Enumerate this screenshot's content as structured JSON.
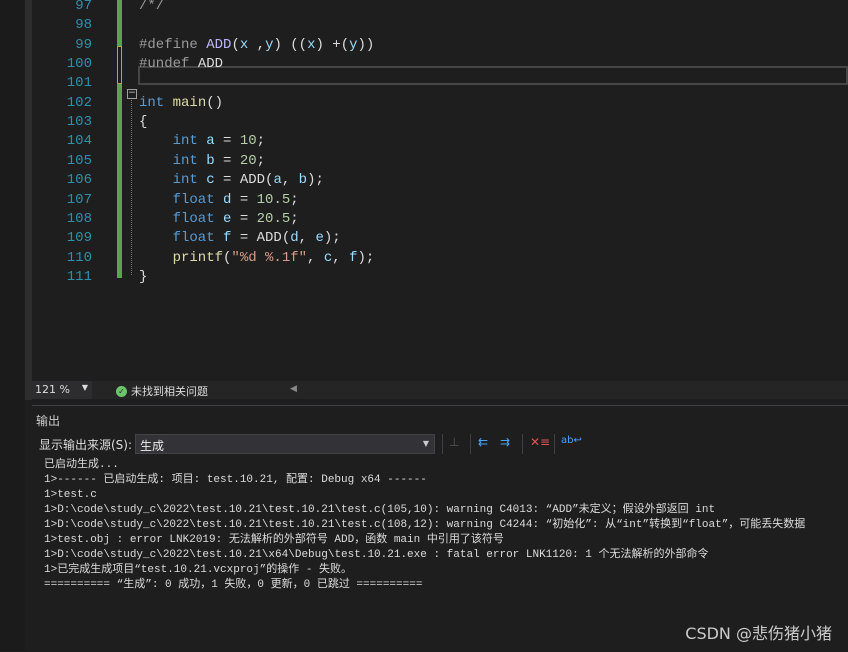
{
  "editor": {
    "lines": [
      {
        "n": "97",
        "code": [
          {
            "t": "/*/",
            "c": "pp"
          }
        ]
      },
      {
        "n": "98",
        "code": []
      },
      {
        "n": "99",
        "code": [
          {
            "t": "#define ",
            "c": "pp"
          },
          {
            "t": "ADD",
            "c": "mac"
          },
          {
            "t": "(",
            "c": ""
          },
          {
            "t": "x",
            "c": "var"
          },
          {
            "t": " ,",
            "c": ""
          },
          {
            "t": "y",
            "c": "var"
          },
          {
            "t": ") ((",
            "c": ""
          },
          {
            "t": "x",
            "c": "var"
          },
          {
            "t": ") +(",
            "c": ""
          },
          {
            "t": "y",
            "c": "var"
          },
          {
            "t": "))",
            "c": ""
          }
        ]
      },
      {
        "n": "100",
        "code": [
          {
            "t": "#undef ",
            "c": "pp"
          },
          {
            "t": "ADD",
            "c": ""
          }
        ]
      },
      {
        "n": "101",
        "code": []
      },
      {
        "n": "102",
        "code": [
          {
            "t": "int ",
            "c": "kw"
          },
          {
            "t": "main",
            "c": "fn"
          },
          {
            "t": "()",
            "c": ""
          }
        ]
      },
      {
        "n": "103",
        "code": [
          {
            "t": "{",
            "c": ""
          }
        ]
      },
      {
        "n": "104",
        "code": [
          {
            "t": "    int ",
            "c": "kw"
          },
          {
            "t": "a",
            "c": "var"
          },
          {
            "t": " = ",
            "c": ""
          },
          {
            "t": "10",
            "c": "num"
          },
          {
            "t": ";",
            "c": ""
          }
        ]
      },
      {
        "n": "105",
        "code": [
          {
            "t": "    int ",
            "c": "kw"
          },
          {
            "t": "b",
            "c": "var"
          },
          {
            "t": " = ",
            "c": ""
          },
          {
            "t": "20",
            "c": "num"
          },
          {
            "t": ";",
            "c": ""
          }
        ]
      },
      {
        "n": "106",
        "code": [
          {
            "t": "    int ",
            "c": "kw"
          },
          {
            "t": "c",
            "c": "var"
          },
          {
            "t": " = ADD(",
            "c": ""
          },
          {
            "t": "a",
            "c": "var"
          },
          {
            "t": ", ",
            "c": ""
          },
          {
            "t": "b",
            "c": "var"
          },
          {
            "t": ");",
            "c": ""
          }
        ]
      },
      {
        "n": "107",
        "code": [
          {
            "t": "    float ",
            "c": "kw"
          },
          {
            "t": "d",
            "c": "var"
          },
          {
            "t": " = ",
            "c": ""
          },
          {
            "t": "10.5",
            "c": "num"
          },
          {
            "t": ";",
            "c": ""
          }
        ]
      },
      {
        "n": "108",
        "code": [
          {
            "t": "    float ",
            "c": "kw"
          },
          {
            "t": "e",
            "c": "var"
          },
          {
            "t": " = ",
            "c": ""
          },
          {
            "t": "20.5",
            "c": "num"
          },
          {
            "t": ";",
            "c": ""
          }
        ]
      },
      {
        "n": "109",
        "code": [
          {
            "t": "    float ",
            "c": "kw"
          },
          {
            "t": "f",
            "c": "var"
          },
          {
            "t": " = ADD(",
            "c": ""
          },
          {
            "t": "d",
            "c": "var"
          },
          {
            "t": ", ",
            "c": ""
          },
          {
            "t": "e",
            "c": "var"
          },
          {
            "t": ");",
            "c": ""
          }
        ]
      },
      {
        "n": "110",
        "code": [
          {
            "t": "    printf",
            "c": "fn"
          },
          {
            "t": "(",
            "c": ""
          },
          {
            "t": "\"%d %.1f\"",
            "c": "str"
          },
          {
            "t": ", ",
            "c": ""
          },
          {
            "t": "c",
            "c": "var"
          },
          {
            "t": ", ",
            "c": ""
          },
          {
            "t": "f",
            "c": "var"
          },
          {
            "t": ");",
            "c": ""
          }
        ]
      },
      {
        "n": "111",
        "code": [
          {
            "t": "}",
            "c": ""
          }
        ]
      }
    ]
  },
  "status": {
    "zoom": "121 %",
    "issues": "未找到相关问题"
  },
  "output": {
    "title": "输出",
    "source_label": "显示输出来源(S):",
    "source_value": "生成",
    "lines": [
      "已启动生成...",
      "1>------ 已启动生成: 项目: test.10.21, 配置: Debug x64 ------",
      "1>test.c",
      "1>D:\\code\\study_c\\2022\\test.10.21\\test.10.21\\test.c(105,10): warning C4013: “ADD”未定义；假设外部返回 int",
      "1>D:\\code\\study_c\\2022\\test.10.21\\test.10.21\\test.c(108,12): warning C4244: “初始化”: 从“int”转换到“float”，可能丢失数据",
      "1>test.obj : error LNK2019: 无法解析的外部符号 ADD，函数 main 中引用了该符号",
      "1>D:\\code\\study_c\\2022\\test.10.21\\x64\\Debug\\test.10.21.exe : fatal error LNK1120: 1 个无法解析的外部命令",
      "1>已完成生成项目“test.10.21.vcxproj”的操作 - 失败。",
      "========== “生成”: 0 成功，1 失败，0 更新，0 已跳过 =========="
    ]
  },
  "watermark": "CSDN @悲伤猪小猪"
}
